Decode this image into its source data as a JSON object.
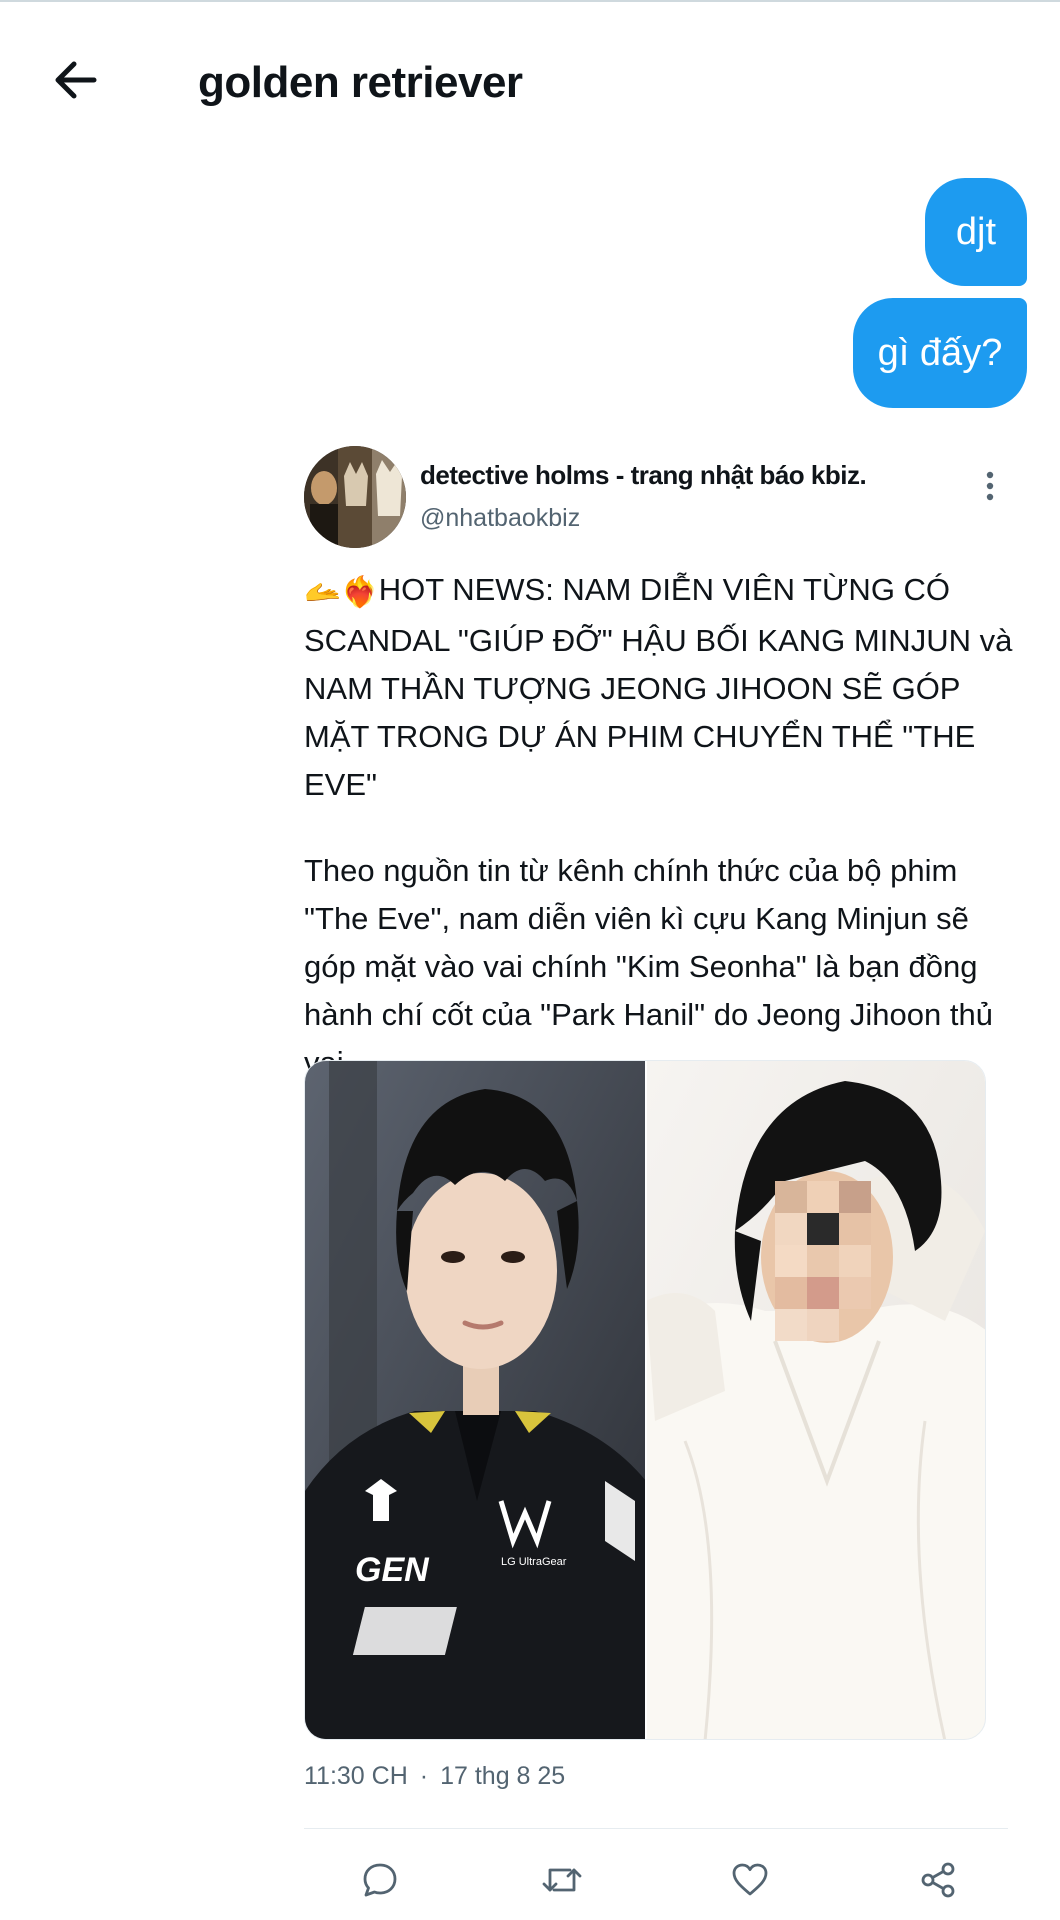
{
  "header": {
    "back_icon": "arrow-left-icon",
    "title": "golden retriever"
  },
  "messages": [
    {
      "text": "djt",
      "from": "me"
    },
    {
      "text": "gì đấy?",
      "from": "me"
    }
  ],
  "tweet": {
    "author_name": "detective holms - trang nhật báo kbiz.",
    "author_handle": "@nhatbaokbiz",
    "emoji_1": "🫴",
    "emoji_2": "❤️‍🔥",
    "headline": "HOT NEWS: NAM DIỄN VIÊN TỪNG CÓ SCANDAL \"GIÚP ĐỠ\" HẬU BỐI KANG MINJUN và NAM THẦN TƯỢNG JEONG JIHOON SẼ GÓP MẶT TRONG DỰ ÁN PHIM CHUYỂN THỂ \"THE EVE\"",
    "body": "Theo nguồn tin từ kênh chính thức của bộ phim \"The Eve\", nam diễn viên kì cựu Kang Minjun sẽ góp mặt vào vai chính \"Kim Seonha\" là bạn đồng hành chí cốt của \"Park Hanil\" do Jeong Jihoon thủ vai.",
    "time": "11:30 CH",
    "separator": "·",
    "date": "17 thg 8 25",
    "jersey_text": "GEN",
    "jersey_brand": "LG UltraGear"
  },
  "actions": [
    "reply-icon",
    "retweet-icon",
    "like-icon",
    "share-icon"
  ],
  "colors": {
    "accent": "#1d9bf0",
    "text": "#0f1419",
    "muted": "#536471"
  }
}
